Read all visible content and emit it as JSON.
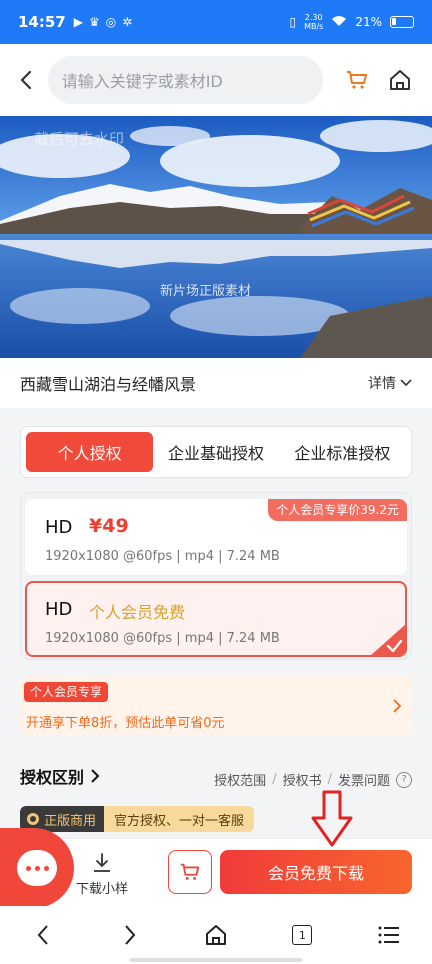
{
  "status_bar": {
    "time": "14:57",
    "speed_top": "2.30",
    "speed_bottom": "MB/s",
    "battery": "21%"
  },
  "header": {
    "search_placeholder": "请输入关键字或素材ID",
    "back_icon": "chevron-left-icon",
    "cart_icon": "cart-icon",
    "home_icon": "home-icon"
  },
  "hero": {
    "watermark_top": "截后可去水印",
    "watermark_center": "新片场正版素材"
  },
  "title_row": {
    "title": "西藏雪山湖泊与经幡风景",
    "details_label": "详情"
  },
  "license_tabs": [
    {
      "label": "个人授权",
      "active": true
    },
    {
      "label": "企业基础授权",
      "active": false
    },
    {
      "label": "企业标准授权",
      "active": false
    }
  ],
  "price_options": [
    {
      "quality": "HD",
      "price": "¥49",
      "specs": "1920x1080 @60fps | mp4 | 7.24 MB",
      "member_tag": "个人会员专享价39.2元",
      "selected": false
    },
    {
      "quality": "HD",
      "price_text": "个人会员免费",
      "specs": "1920x1080 @60fps | mp4 | 7.24 MB",
      "selected": true
    }
  ],
  "promo": {
    "tag": "个人会员专享",
    "text": "开通享下单8折，预估此单可省0元"
  },
  "license_section": {
    "title": "授权区别",
    "links": [
      "授权范围",
      "授权书",
      "发票问题"
    ],
    "badge_dark": "正版商用",
    "badge_light": "官方授权、一对一客服"
  },
  "action_bar": {
    "download_sample": "下载小样",
    "free_download": "会员免费下载"
  },
  "nav_bar": {
    "tab_count": "1"
  },
  "colors": {
    "accent_red": "#f14a3a",
    "status_blue": "#1f7af7",
    "gold": "#d7a22c",
    "promo_orange": "#f06a1c"
  }
}
